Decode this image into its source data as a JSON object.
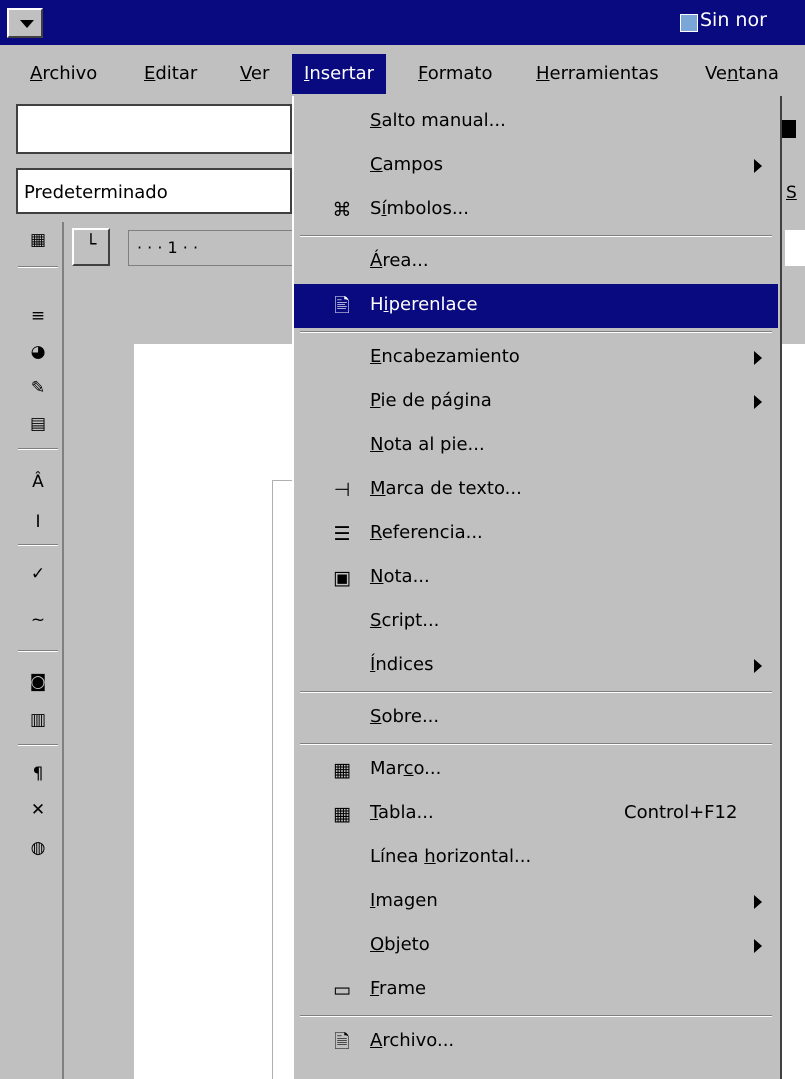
{
  "window": {
    "title": "Sin nor",
    "system_button": "chevron-down"
  },
  "menubar": [
    {
      "key": "archivo",
      "label": "Archivo",
      "u": 0
    },
    {
      "key": "editar",
      "label": "Editar",
      "u": 0
    },
    {
      "key": "ver",
      "label": "Ver",
      "u": 0
    },
    {
      "key": "insertar",
      "label": "Insertar",
      "u": 0,
      "active": true
    },
    {
      "key": "formato",
      "label": "Formato",
      "u": 0
    },
    {
      "key": "herramientas",
      "label": "Herramientas",
      "u": 0
    },
    {
      "key": "ventana",
      "label": "Ventana",
      "u": 2
    }
  ],
  "toolbar": {
    "url_value": "",
    "style_value": "Predeterminado",
    "right_partial": "S"
  },
  "ruler": {
    "text": "· · · 1 · · "
  },
  "insert_menu": [
    {
      "type": "item",
      "key": "salto-manual",
      "label": "Salto manual...",
      "u": 0
    },
    {
      "type": "item",
      "key": "campos",
      "label": "Campos",
      "u": 0,
      "submenu": true
    },
    {
      "type": "item",
      "key": "simbolos",
      "label": "Símbolos...",
      "u": 1,
      "icon": "symbol-icon",
      "glyph": "⌘"
    },
    {
      "type": "sep"
    },
    {
      "type": "item",
      "key": "area",
      "label": "Área...",
      "u": 0
    },
    {
      "type": "item",
      "key": "hiperenlace",
      "label": "Hiperenlace",
      "u": 1,
      "icon": "hyperlink-icon",
      "glyph": "🖹",
      "highlight": true
    },
    {
      "type": "sep"
    },
    {
      "type": "item",
      "key": "encabezamiento",
      "label": "Encabezamiento",
      "u": 0,
      "submenu": true
    },
    {
      "type": "item",
      "key": "pie-de-pagina",
      "label": "Pie de página",
      "u": 0,
      "submenu": true
    },
    {
      "type": "item",
      "key": "nota-al-pie",
      "label": "Nota al pie...",
      "u": 0
    },
    {
      "type": "item",
      "key": "marca-de-texto",
      "label": "Marca de texto...",
      "u": 0,
      "icon": "bookmark-icon",
      "glyph": "⊣"
    },
    {
      "type": "item",
      "key": "referencia",
      "label": "Referencia...",
      "u": 0,
      "icon": "reference-icon",
      "glyph": "☰"
    },
    {
      "type": "item",
      "key": "nota",
      "label": "Nota...",
      "u": 0,
      "icon": "note-icon",
      "glyph": "▣"
    },
    {
      "type": "item",
      "key": "script",
      "label": "Script...",
      "u": 0
    },
    {
      "type": "item",
      "key": "indices",
      "label": "Índices",
      "u": 0,
      "submenu": true
    },
    {
      "type": "sep"
    },
    {
      "type": "item",
      "key": "sobre",
      "label": "Sobre...",
      "u": 0
    },
    {
      "type": "sep"
    },
    {
      "type": "item",
      "key": "marco",
      "label": "Marco...",
      "u": 3,
      "icon": "frame-icon",
      "glyph": "▦"
    },
    {
      "type": "item",
      "key": "tabla",
      "label": "Tabla...",
      "u": 0,
      "icon": "table-icon",
      "glyph": "▦",
      "shortcut": "Control+F12"
    },
    {
      "type": "item",
      "key": "linea-horizontal",
      "label": "Línea horizontal...",
      "u": 6
    },
    {
      "type": "item",
      "key": "imagen",
      "label": "Imagen",
      "u": 0,
      "submenu": true
    },
    {
      "type": "item",
      "key": "objeto",
      "label": "Objeto",
      "u": 0,
      "submenu": true
    },
    {
      "type": "item",
      "key": "frame",
      "label": "Frame",
      "u": 0,
      "icon": "floating-frame-icon",
      "glyph": "▭"
    },
    {
      "type": "sep"
    },
    {
      "type": "item",
      "key": "archivo-ins",
      "label": "Archivo...",
      "u": 0,
      "icon": "file-icon",
      "glyph": "🗎"
    }
  ],
  "left_toolbar": [
    {
      "name": "insert-table-icon",
      "glyph": "▦"
    },
    {
      "name": "insert-fields-icon",
      "glyph": "≡"
    },
    {
      "name": "insert-object-icon",
      "glyph": "◕"
    },
    {
      "name": "draw-functions-icon",
      "glyph": "✎"
    },
    {
      "name": "form-functions-icon",
      "glyph": "▤"
    },
    {
      "name": "edit-autotext-icon",
      "glyph": "Â"
    },
    {
      "name": "direct-cursor-icon",
      "glyph": "I"
    },
    {
      "name": "spellcheck-icon",
      "glyph": "✓"
    },
    {
      "name": "autospellcheck-icon",
      "glyph": "~"
    },
    {
      "name": "find-replace-icon",
      "glyph": "◙"
    },
    {
      "name": "data-sources-icon",
      "glyph": "▥"
    },
    {
      "name": "nonprinting-chars-icon",
      "glyph": "¶"
    },
    {
      "name": "graphics-off-icon",
      "glyph": "✕"
    },
    {
      "name": "online-layout-icon",
      "glyph": "◍"
    }
  ],
  "colors": {
    "menu_bg": "#c0c0c0",
    "highlight": "#0a0a80",
    "title_bg": "#0a0a80"
  }
}
